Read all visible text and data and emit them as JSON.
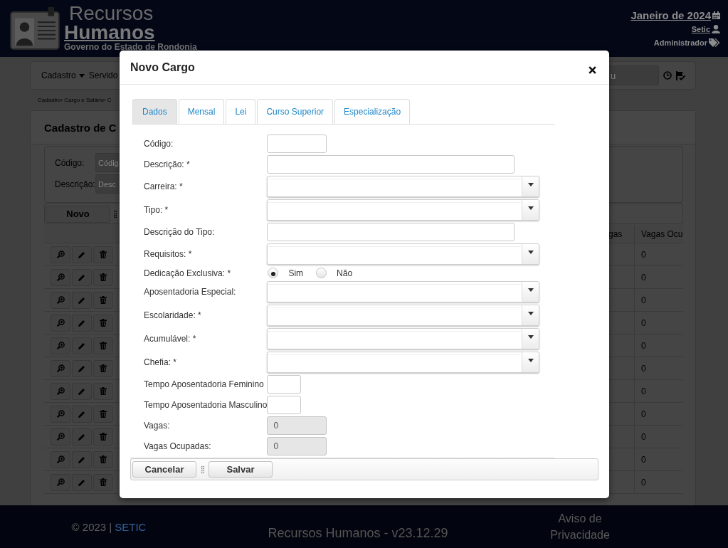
{
  "header": {
    "title": "Recursos",
    "title_emphasis": "Humanos",
    "subtitle": "Governo do Estado de Rondonia",
    "period": "Janeiro de 2024",
    "user": "Setic",
    "role": "Administrador"
  },
  "navbar": {
    "menus": [
      {
        "label": "Cadastro",
        "dropdown": true
      },
      {
        "label": "Servido",
        "dropdown": false
      }
    ],
    "search": {
      "placeholder": "u"
    }
  },
  "breadcrumb": "Cadastro› Cargo e Salário› C",
  "panel": {
    "title": "Cadastro de C",
    "filters": [
      {
        "label": "Código:",
        "placeholder": "Códig"
      },
      {
        "label": "Descrição:",
        "placeholder": "Desc"
      }
    ],
    "new_button": "Novo",
    "table": {
      "columns": [
        "gas",
        "Vagas Ocu"
      ],
      "rows": [
        {
          "vagas_ocupadas": "0"
        },
        {
          "vagas_ocupadas": "0"
        },
        {
          "vagas_ocupadas": "0"
        },
        {
          "vagas_ocupadas": "0"
        },
        {
          "vagas_ocupadas": "0"
        },
        {
          "vagas_ocupadas": "0"
        },
        {
          "vagas_ocupadas": "0"
        },
        {
          "vagas_ocupadas": "0"
        },
        {
          "vagas_ocupadas": "0"
        },
        {
          "vagas_ocupadas": "0"
        },
        {
          "vagas_ocupadas": "0"
        }
      ]
    }
  },
  "modal": {
    "title": "Novo Cargo",
    "tabs": [
      {
        "label": "Dados",
        "selected": true
      },
      {
        "label": "Mensal",
        "selected": false
      },
      {
        "label": "Lei",
        "selected": false
      },
      {
        "label": "Curso Superior",
        "selected": false
      },
      {
        "label": "Especialização",
        "selected": false
      }
    ],
    "fields": [
      {
        "label": "Código:",
        "kind": "short",
        "disabled": false
      },
      {
        "label": "Descrição: *",
        "kind": "text",
        "disabled": false
      },
      {
        "label": "Carreira: *",
        "kind": "select",
        "disabled": false
      },
      {
        "label": "Tipo: *",
        "kind": "select",
        "disabled": false
      },
      {
        "label": "Descrição do Tipo:",
        "kind": "text",
        "disabled": false
      },
      {
        "label": "Requisitos: *",
        "kind": "select",
        "disabled": false
      },
      {
        "label": "Dedicação Exclusiva: *",
        "kind": "radio",
        "disabled": false,
        "options": [
          {
            "label": "Sim",
            "selected": true
          },
          {
            "label": "Não",
            "selected": false
          }
        ]
      },
      {
        "label": "Aposentadoria Especial:",
        "kind": "select",
        "disabled": false
      },
      {
        "label": "Escolaridade: *",
        "kind": "select",
        "disabled": false
      },
      {
        "label": "Acumulável: *",
        "kind": "select",
        "disabled": false
      },
      {
        "label": "Chefia: *",
        "kind": "select",
        "disabled": false
      },
      {
        "label": "Tempo Aposentadoria Feminino",
        "kind": "number",
        "disabled": false
      },
      {
        "label": "Tempo Aposentadoria Masculino",
        "kind": "number",
        "disabled": false
      },
      {
        "label": "Vagas:",
        "kind": "short",
        "disabled": true,
        "value": "0"
      },
      {
        "label": "Vagas Ocupadas:",
        "kind": "short",
        "disabled": true,
        "value": "0"
      }
    ],
    "buttons": [
      "Cancelar",
      "Salvar"
    ]
  },
  "footer": {
    "copyright": "© 2023 |",
    "link": "SETIC",
    "version": "Recursos Humanos - v23.12.29",
    "privacy": "Aviso de Privacidade"
  }
}
